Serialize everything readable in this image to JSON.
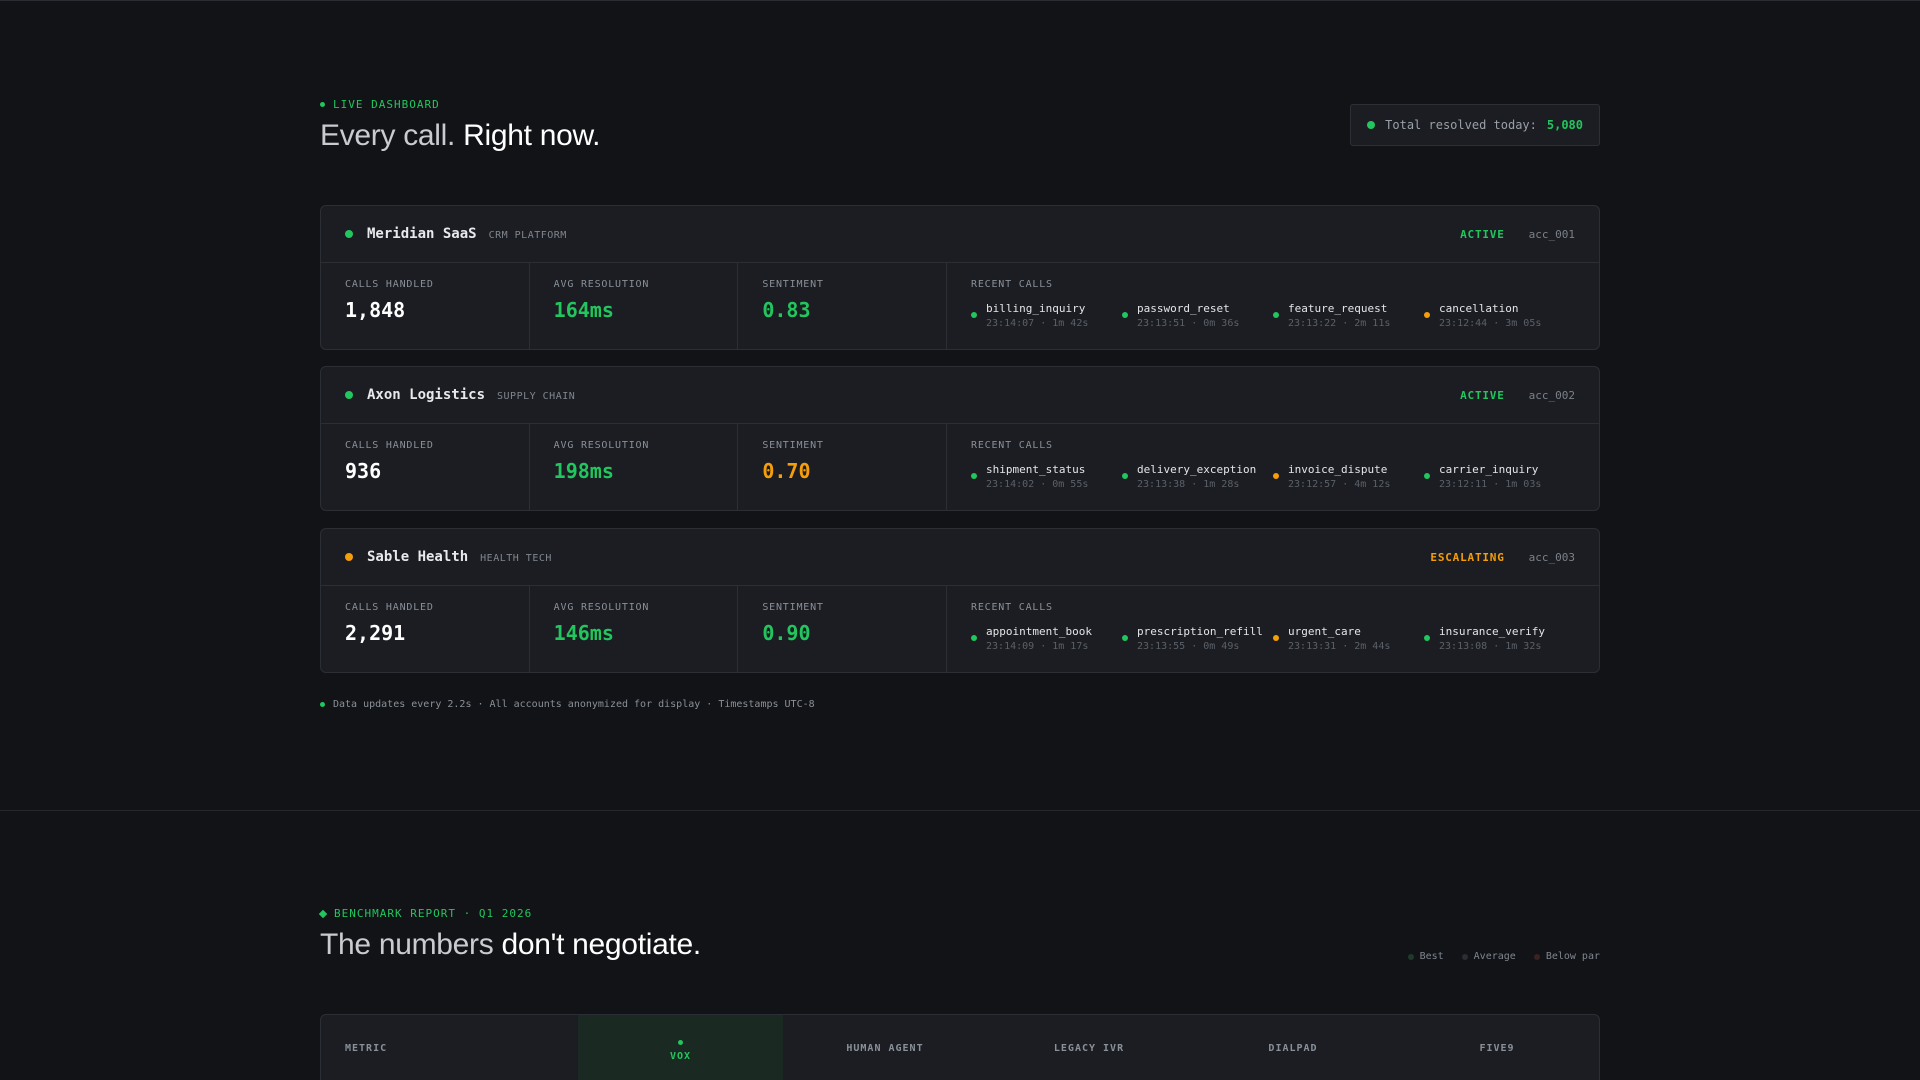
{
  "live": {
    "eyebrow": "LIVE DASHBOARD",
    "headline_dim": "Every call.",
    "headline_bright": "Right now.",
    "total_label": "Total resolved today:",
    "total_value": "5,080"
  },
  "accounts": [
    {
      "name": "Meridian SaaS",
      "type": "CRM PLATFORM",
      "status": "ACTIVE",
      "status_color": "#22c55e",
      "id": "acc_001",
      "calls_label": "CALLS HANDLED",
      "calls": "1,848",
      "res_label": "AVG RESOLUTION",
      "resolution": "164ms",
      "resolution_color": "#22c55e",
      "sent_label": "SENTIMENT",
      "sentiment": "0.83",
      "sentiment_color": "#22c55e",
      "recent_label": "RECENT CALLS",
      "recent": [
        {
          "name": "billing_inquiry",
          "meta": "23:14:07 · 1m 42s",
          "color": "#22c55e"
        },
        {
          "name": "password_reset",
          "meta": "23:13:51 · 0m 36s",
          "color": "#22c55e"
        },
        {
          "name": "feature_request",
          "meta": "23:13:22 · 2m 11s",
          "color": "#22c55e"
        },
        {
          "name": "cancellation",
          "meta": "23:12:44 · 3m 05s",
          "color": "#f59e0b"
        }
      ]
    },
    {
      "name": "Axon Logistics",
      "type": "SUPPLY CHAIN",
      "status": "ACTIVE",
      "status_color": "#22c55e",
      "id": "acc_002",
      "calls_label": "CALLS HANDLED",
      "calls": "936",
      "res_label": "AVG RESOLUTION",
      "resolution": "198ms",
      "resolution_color": "#22c55e",
      "sent_label": "SENTIMENT",
      "sentiment": "0.70",
      "sentiment_color": "#f59e0b",
      "recent_label": "RECENT CALLS",
      "recent": [
        {
          "name": "shipment_status",
          "meta": "23:14:02 · 0m 55s",
          "color": "#22c55e"
        },
        {
          "name": "delivery_exception",
          "meta": "23:13:38 · 1m 28s",
          "color": "#22c55e"
        },
        {
          "name": "invoice_dispute",
          "meta": "23:12:57 · 4m 12s",
          "color": "#f59e0b"
        },
        {
          "name": "carrier_inquiry",
          "meta": "23:12:11 · 1m 03s",
          "color": "#22c55e"
        }
      ]
    },
    {
      "name": "Sable Health",
      "type": "HEALTH TECH",
      "status": "ESCALATING",
      "status_color": "#f59e0b",
      "id": "acc_003",
      "calls_label": "CALLS HANDLED",
      "calls": "2,291",
      "res_label": "AVG RESOLUTION",
      "resolution": "146ms",
      "resolution_color": "#22c55e",
      "sent_label": "SENTIMENT",
      "sentiment": "0.90",
      "sentiment_color": "#22c55e",
      "recent_label": "RECENT CALLS",
      "recent": [
        {
          "name": "appointment_book",
          "meta": "23:14:09 · 1m 17s",
          "color": "#22c55e"
        },
        {
          "name": "prescription_refill",
          "meta": "23:13:55 · 0m 49s",
          "color": "#22c55e"
        },
        {
          "name": "urgent_care",
          "meta": "23:13:31 · 2m 44s",
          "color": "#f59e0b"
        },
        {
          "name": "insurance_verify",
          "meta": "23:13:08 · 1m 32s",
          "color": "#22c55e"
        }
      ]
    }
  ],
  "footnote": "Data updates every 2.2s · All accounts anonymized for display · Timestamps UTC-8",
  "bench": {
    "eyebrow": "BENCHMARK REPORT · Q1 2026",
    "headline_dim": "The numbers",
    "headline_bright": "don't negotiate.",
    "legend": [
      {
        "label": "Best",
        "color": "#1f3a2b"
      },
      {
        "label": "Average",
        "color": "#2a2d33"
      },
      {
        "label": "Below par",
        "color": "#3a2222"
      }
    ],
    "columns": [
      "METRIC",
      "VOX",
      "HUMAN AGENT",
      "LEGACY IVR",
      "DIALPAD",
      "FIVE9"
    ]
  }
}
